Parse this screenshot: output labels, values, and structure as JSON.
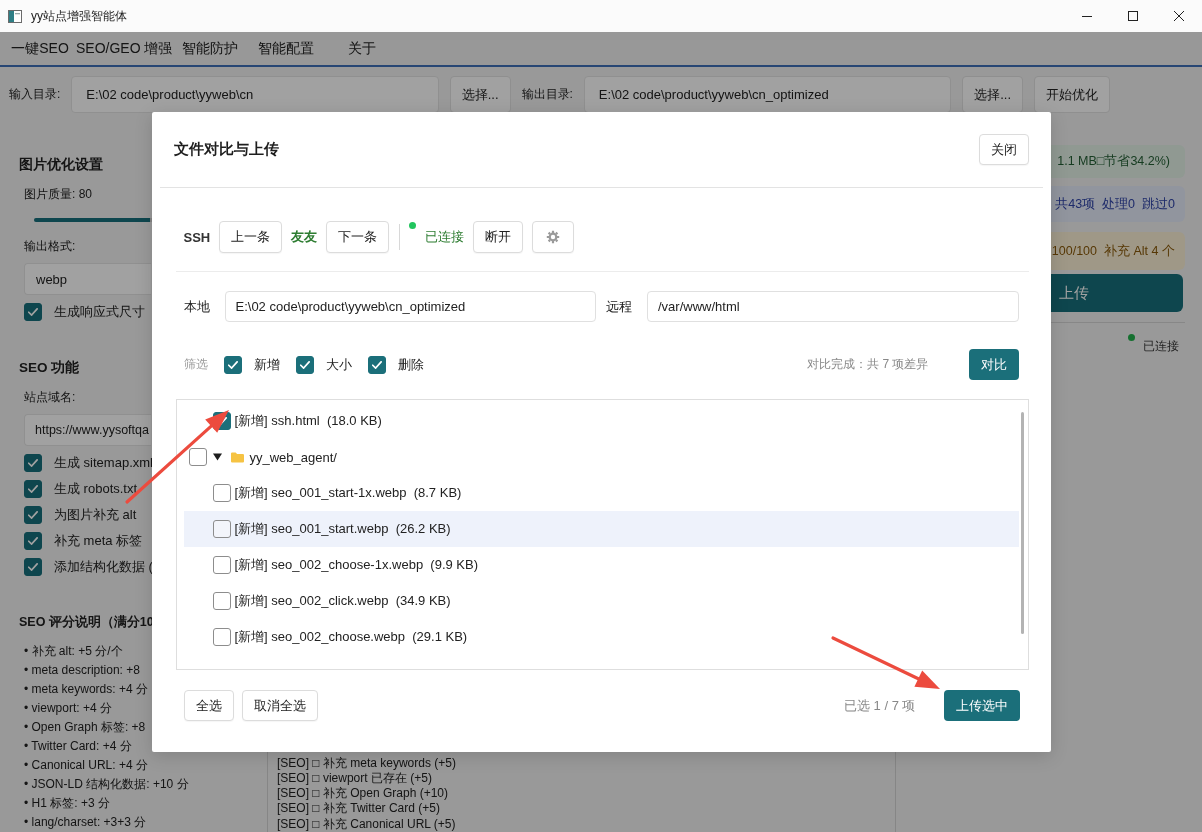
{
  "window": {
    "title": "yy站点增强智能体"
  },
  "menu": [
    "一键SEO",
    "SEO/GEO 增强",
    "智能防护",
    "智能配置",
    "关于"
  ],
  "toolbar": {
    "input_label": "输入目录:",
    "input_path": "E:\\02 code\\product\\yyweb\\cn",
    "input_browse_button": "选择...",
    "output_label": "输出目录:",
    "output_path": "E:\\02 code\\product\\yyweb\\cn_optimized",
    "output_browse_button": "选择...",
    "start_button": "开始优化"
  },
  "image_settings": {
    "title": "图片优化设置",
    "quality_label": "图片质量: 80",
    "quality_slider": {
      "level": 0.8
    },
    "format_label": "输出格式:",
    "format_value": "webp",
    "options": [
      {
        "label": "生成响应式尺寸",
        "checked": true
      }
    ]
  },
  "seo_settings": {
    "title": "SEO 功能",
    "domain_label": "站点域名:",
    "domain_value": "https://www.yysoftqa",
    "options": [
      {
        "label": "生成 sitemap.xml",
        "checked": true
      },
      {
        "label": "生成 robots.txt",
        "checked": true
      },
      {
        "label": "为图片补充 alt",
        "checked": true
      },
      {
        "label": "补充 meta 标签",
        "checked": true
      },
      {
        "label": "添加结构化数据 (",
        "checked": true
      }
    ]
  },
  "score_guide": {
    "title": "SEO 评分说明（满分10",
    "items": [
      "• 补充 alt: +5 分/个",
      "• meta description: +8",
      "• meta keywords: +4 分",
      "• viewport: +4 分",
      "• Open Graph 标签: +8",
      "• Twitter Card: +4 分",
      "• Canonical URL: +4 分",
      "• JSON-LD 结构化数据: +10 分",
      "• H1 标签: +3 分",
      "• lang/charset: +3+3 分"
    ]
  },
  "log_lines": [
    "[SEO] □ 补充 meta keywords (+5)",
    "[SEO] □ viewport 已存在 (+5)",
    "[SEO] □ 补充 Open Graph (+10)",
    "[SEO] □ 补充 Twitter Card (+5)",
    "[SEO] □ 补充 Canonical URL (+5)"
  ],
  "summary_panel": {
    "savings": "1.1 MB□节省34.2%)",
    "counts": [
      "共43项",
      "处理0",
      "跳过0"
    ],
    "score": [
      "100/100",
      "补充 Alt 4 个"
    ],
    "upload_button": "上传",
    "connection": {
      "label": "已连接",
      "connected": true
    }
  },
  "dialog": {
    "title": "文件对比与上传",
    "close_button": "关闭",
    "ssh": {
      "label": "SSH",
      "previous_button": "上一条",
      "host_name": "友友",
      "next_button": "下一条",
      "status": {
        "label": "已连接",
        "connected": true
      },
      "disconnect_button": "断开"
    },
    "paths": {
      "local_label": "本地",
      "local_path": "E:\\02 code\\product\\yyweb\\cn_optimized",
      "remote_label": "远程",
      "remote_path": "/var/www/html"
    },
    "filter": {
      "label": "筛选",
      "options": [
        {
          "label": "新增",
          "checked": true
        },
        {
          "label": "大小",
          "checked": true
        },
        {
          "label": "删除",
          "checked": true
        }
      ],
      "summary": "对比完成：共 7 项差异",
      "compare_button": "对比"
    },
    "files": [
      {
        "kind": "file",
        "label": "[新增] ssh.html  (18.0 KB)",
        "checked": true,
        "highlighted": false
      },
      {
        "kind": "folder",
        "label": "yy_web_agent/",
        "checked": false,
        "expanded": true,
        "highlighted": false,
        "children": [
          {
            "kind": "file",
            "label": "[新增] seo_001_start-1x.webp  (8.7 KB)",
            "checked": false,
            "highlighted": false
          },
          {
            "kind": "file",
            "label": "[新增] seo_001_start.webp  (26.2 KB)",
            "checked": false,
            "highlighted": true
          },
          {
            "kind": "file",
            "label": "[新增] seo_002_choose-1x.webp  (9.9 KB)",
            "checked": false,
            "highlighted": false
          },
          {
            "kind": "file",
            "label": "[新增] seo_002_click.webp  (34.9 KB)",
            "checked": false,
            "highlighted": false
          },
          {
            "kind": "file",
            "label": "[新增] seo_002_choose.webp  (29.1 KB)",
            "checked": false,
            "highlighted": false
          }
        ]
      }
    ],
    "select_all_button": "全选",
    "deselect_all_button": "取消全选",
    "selection_count": "已选 1 / 7 项",
    "upload_button": "上传选中"
  }
}
